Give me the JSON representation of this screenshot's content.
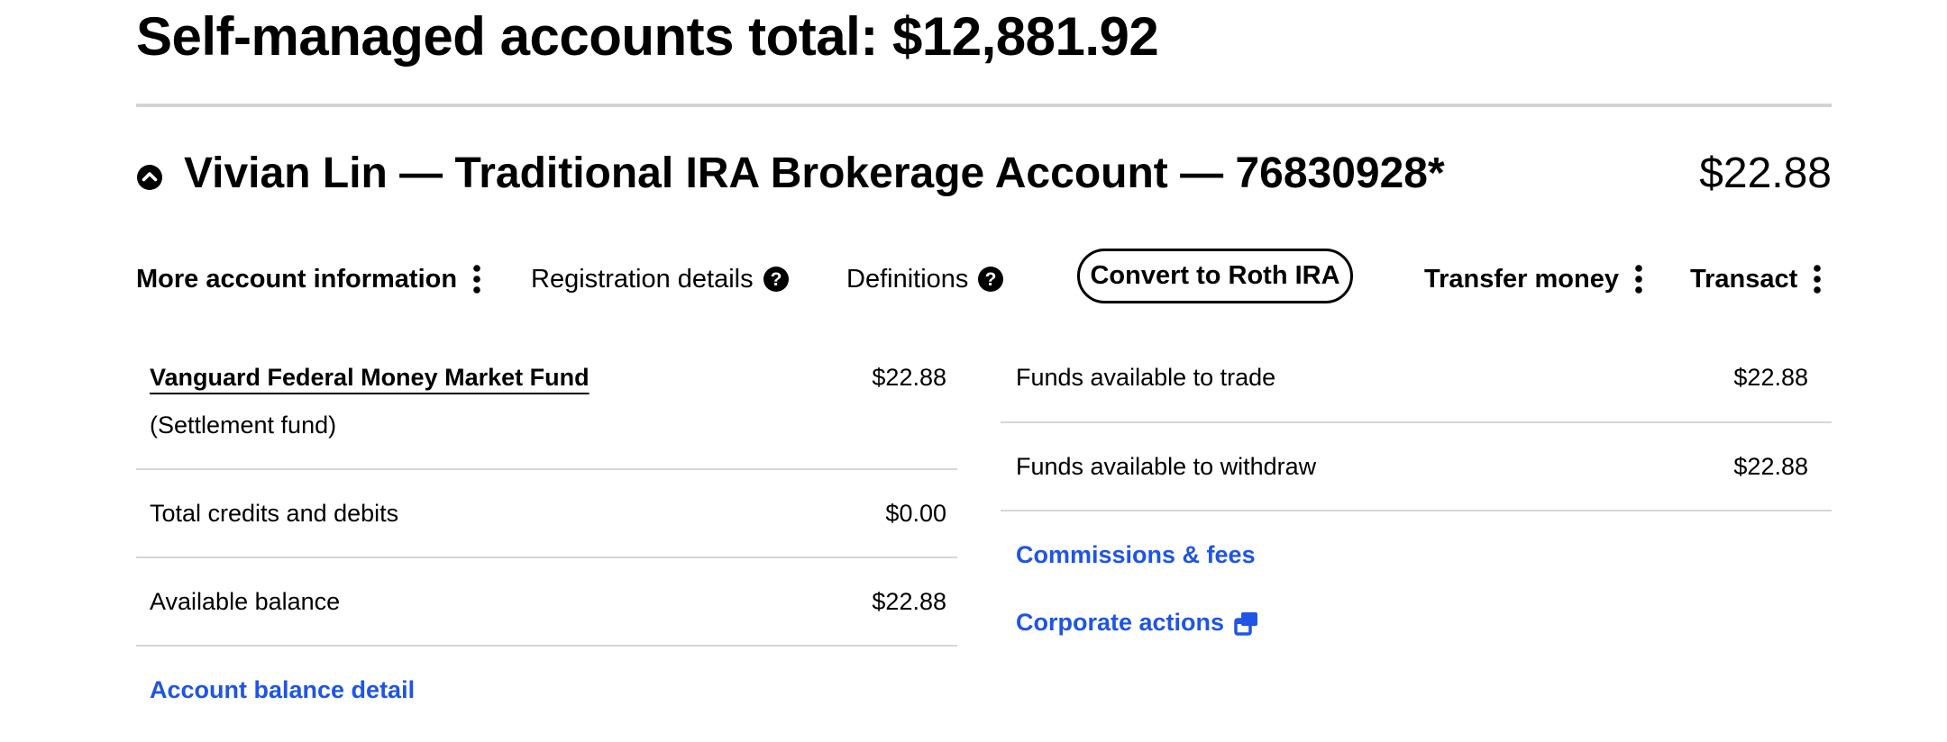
{
  "page": {
    "title": "Self-managed accounts total: $12,881.92"
  },
  "account": {
    "title": "Vivian Lin — Traditional IRA Brokerage Account — 76830928*",
    "total": "$22.88",
    "collapse_icon": "chevron-up-circle-icon"
  },
  "nav": {
    "more_info_label": "More account information",
    "registration_label": "Registration details",
    "definitions_label": "Definitions",
    "convert_label": "Convert to Roth IRA",
    "transfer_label": "Transfer money",
    "transact_label": "Transact",
    "menu_icon": "kebab-icon",
    "help_icon": "question-circle-icon"
  },
  "left_panel": {
    "fund_name": "Vanguard Federal Money Market Fund",
    "fund_subtitle": "(Settlement fund)",
    "fund_value": "$22.88",
    "rows": [
      {
        "label": "Total credits and debits",
        "value": "$0.00"
      },
      {
        "label": "Available balance",
        "value": "$22.88"
      }
    ],
    "link_label": "Account balance detail"
  },
  "right_panel": {
    "rows": [
      {
        "label": "Funds available to trade",
        "value": "$22.88"
      },
      {
        "label": "Funds available to withdraw",
        "value": "$22.88"
      }
    ],
    "commissions_label": "Commissions & fees",
    "corporate_label": "Corporate actions",
    "external_icon": "open-in-new-window-icon"
  },
  "colors": {
    "link": "#1f55e5",
    "divider": "#d6d6d6",
    "text": "#000000"
  }
}
